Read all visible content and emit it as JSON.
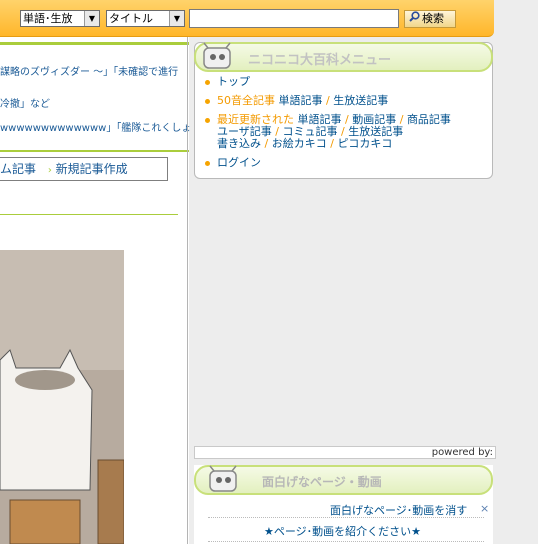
{
  "search": {
    "category_select": "単語･生放",
    "field_select": "タイトル",
    "input_value": "",
    "button_label": "検索"
  },
  "left": {
    "line1": "謀略のズヴィズダー ～」「未確認で進行",
    "line2": "冷撤」など",
    "line3": "wwwwwwwwwwwww」「艦隊これくしょ",
    "article_tab_partial": "ム記事",
    "new_article": "新規記事作成"
  },
  "menu_panel": {
    "title": "ニコニコ大百科メニュー",
    "top": "トップ",
    "row2_lead": "50音全記事",
    "row2_a": "単語記事",
    "row2_b": "生放送記事",
    "row3_lead": "最近更新された",
    "row3_a": "単語記事",
    "row3_b": "動画記事",
    "row3_c": "商品記事",
    "row3_d": "ユーザ記事",
    "row3_e": "コミュ記事",
    "row3_f": "生放送記事",
    "row3_g": "書き込み",
    "row3_h": "お絵カキコ",
    "row3_i": "ピコカキコ",
    "login": "ログイン"
  },
  "powered_by": "powered by:",
  "fun_panel": {
    "title": "面白げなページ・動画",
    "hide_link": "面白げなページ･動画を消す",
    "close": "×",
    "introduce": "★ページ･動画を紹介ください★"
  }
}
